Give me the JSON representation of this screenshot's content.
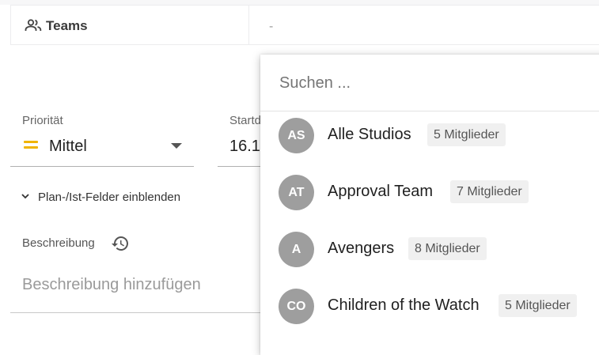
{
  "teams_row": {
    "label": "Teams",
    "value": "-"
  },
  "priority": {
    "label": "Priorität",
    "value": "Mittel",
    "color": "#f0b400"
  },
  "start": {
    "label": "Startd",
    "value": "16.1"
  },
  "plan_toggle": {
    "label": "Plan-/Ist-Felder einblenden"
  },
  "description": {
    "label": "Beschreibung",
    "placeholder": "Beschreibung hinzufügen"
  },
  "team_picker": {
    "search_placeholder": "Suchen ...",
    "items": [
      {
        "initials": "AS",
        "name": "Alle Studios",
        "members": "5 Mitglieder"
      },
      {
        "initials": "AT",
        "name": "Approval Team",
        "members": "7 Mitglieder"
      },
      {
        "initials": "A",
        "name": "Avengers",
        "members": "8 Mitglieder"
      },
      {
        "initials": "CO",
        "name": "Children of the Watch",
        "members": "5 Mitglieder"
      }
    ]
  }
}
